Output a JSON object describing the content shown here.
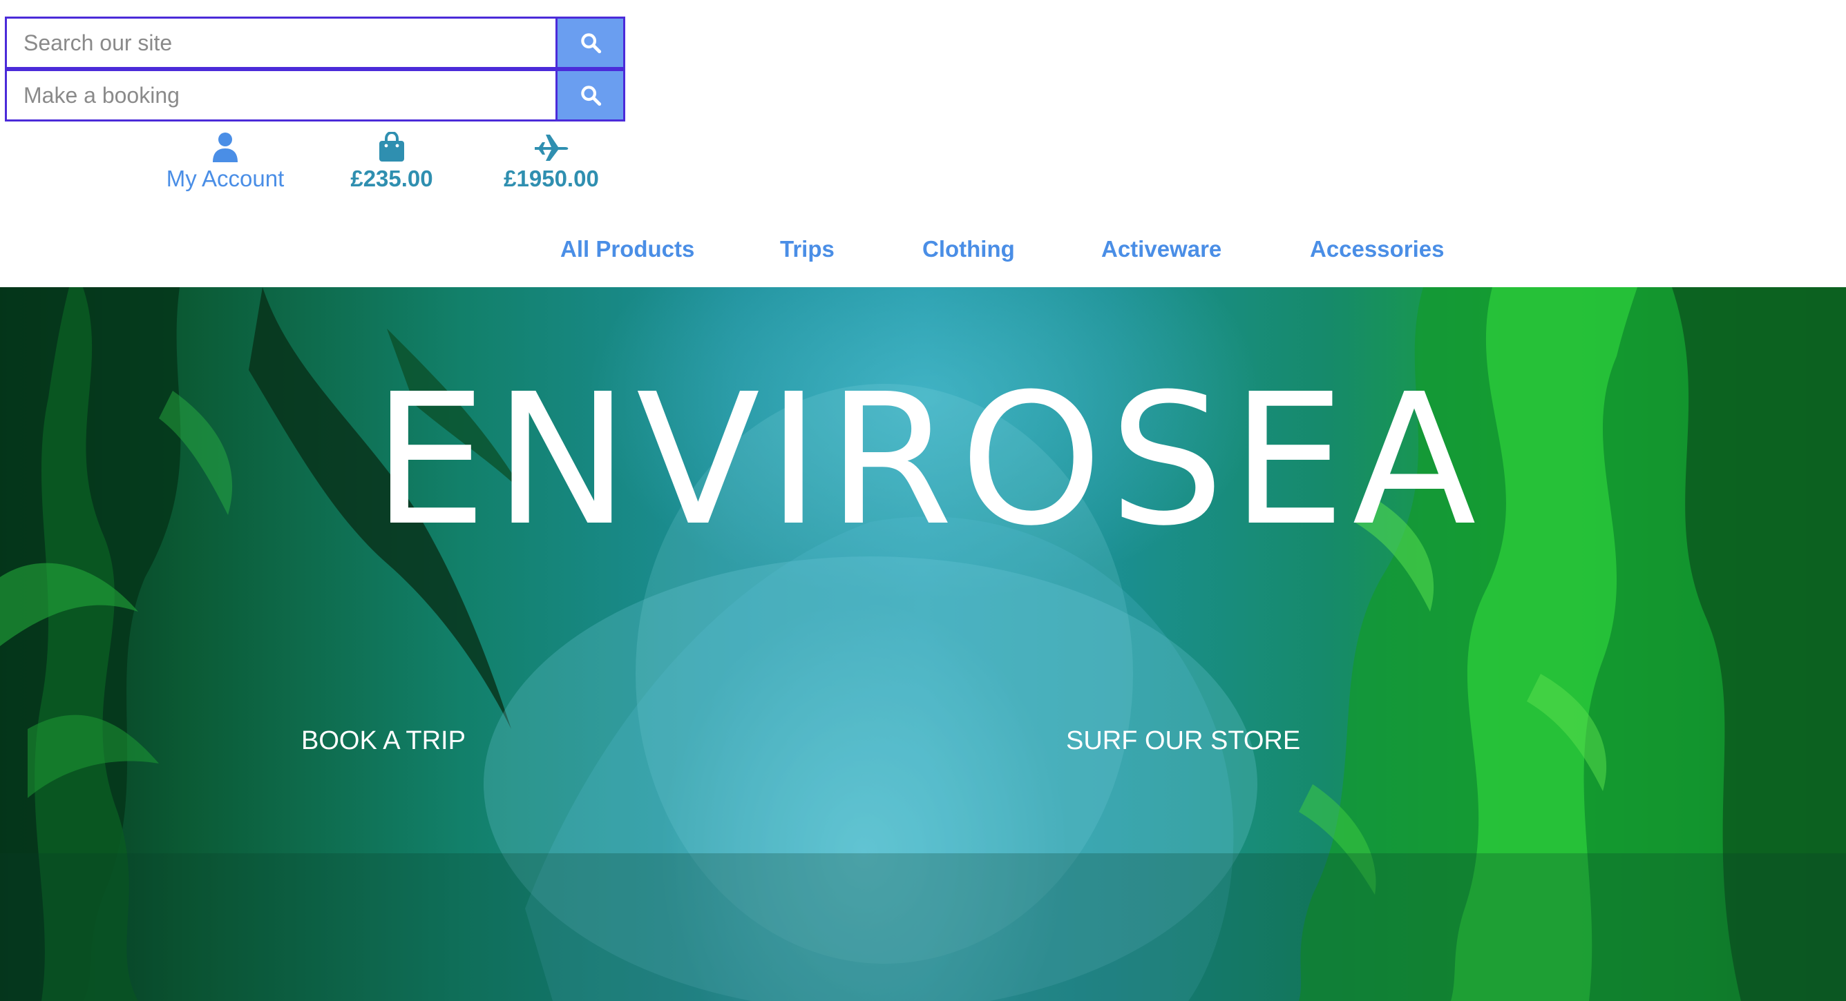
{
  "search": {
    "site_placeholder": "Search our site",
    "booking_placeholder": "Make a booking",
    "button_icon": "search-icon"
  },
  "header_tools": {
    "account": {
      "icon": "user-icon",
      "label": "My Account"
    },
    "basket": {
      "icon": "shopping-bag-icon",
      "label": "£235.00"
    },
    "trips": {
      "icon": "plane-icon",
      "label": "£1950.00"
    }
  },
  "nav": {
    "items": [
      {
        "label": "All Products"
      },
      {
        "label": "Trips"
      },
      {
        "label": "Clothing"
      },
      {
        "label": "Activeware"
      },
      {
        "label": "Accessories"
      }
    ]
  },
  "hero": {
    "title": "ENVIROSEA",
    "book_label": "BOOK A TRIP",
    "store_label": "SURF OUR STORE"
  },
  "colors": {
    "link": "#4a8ee6",
    "price": "#2f8fb0",
    "search_border": "#4b2bd9",
    "search_button": "#6a9ef0"
  }
}
